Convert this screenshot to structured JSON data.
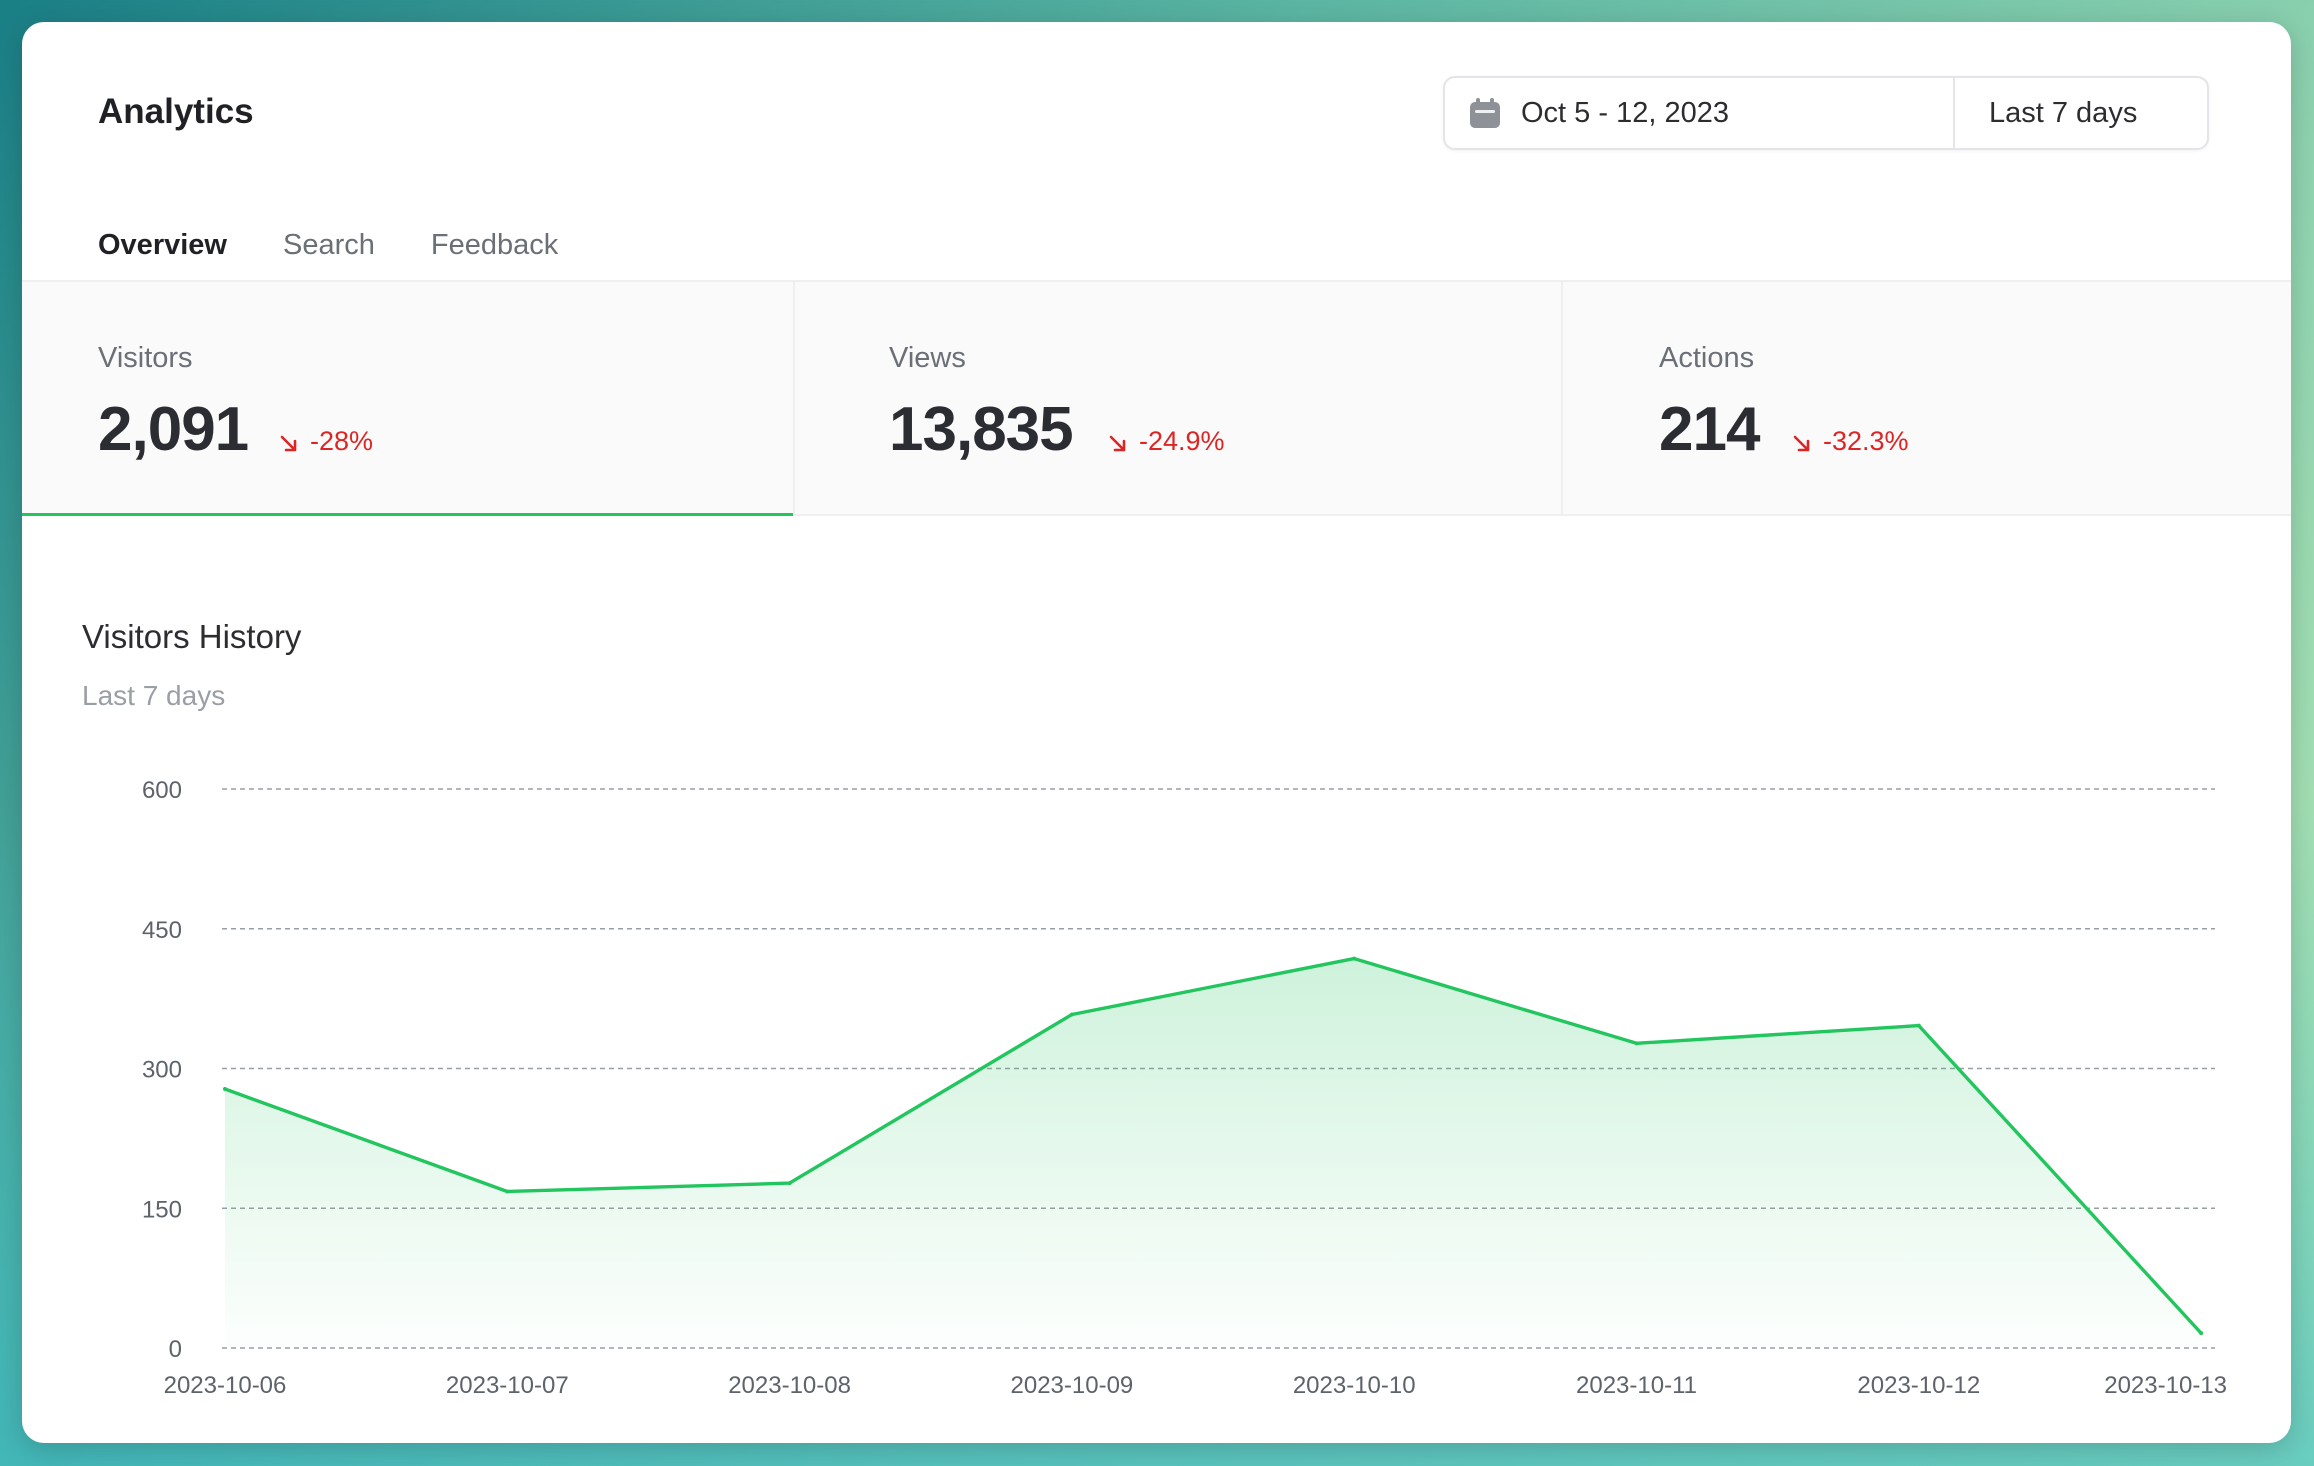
{
  "header": {
    "title": "Analytics",
    "date_range": "Oct 5 - 12, 2023",
    "period": "Last 7 days"
  },
  "tabs": [
    {
      "label": "Overview",
      "active": true
    },
    {
      "label": "Search",
      "active": false
    },
    {
      "label": "Feedback",
      "active": false
    }
  ],
  "metrics": [
    {
      "label": "Visitors",
      "value": "2,091",
      "change": "-28%",
      "selected": true
    },
    {
      "label": "Views",
      "value": "13,835",
      "change": "-24.9%",
      "selected": false
    },
    {
      "label": "Actions",
      "value": "214",
      "change": "-32.3%",
      "selected": false
    }
  ],
  "colors": {
    "accent": "#22c55e",
    "negative": "#dc2626"
  },
  "icons": {
    "calendar": "calendar-icon",
    "trend": "arrow-down-right-icon"
  },
  "chart": {
    "title": "Visitors History",
    "subtitle": "Last 7 days"
  },
  "chart_data": {
    "type": "area",
    "title": "Visitors History",
    "subtitle": "Last 7 days",
    "x": [
      "2023-10-06",
      "2023-10-07",
      "2023-10-08",
      "2023-10-09",
      "2023-10-10",
      "2023-10-11",
      "2023-10-12",
      "2023-10-13"
    ],
    "series": [
      {
        "values": [
          278,
          168,
          177,
          358,
          418,
          327,
          346,
          16
        ]
      }
    ],
    "yticks": [
      0,
      150,
      300,
      450,
      600
    ],
    "ylim": [
      0,
      600
    ],
    "grid": true,
    "legend": false
  }
}
